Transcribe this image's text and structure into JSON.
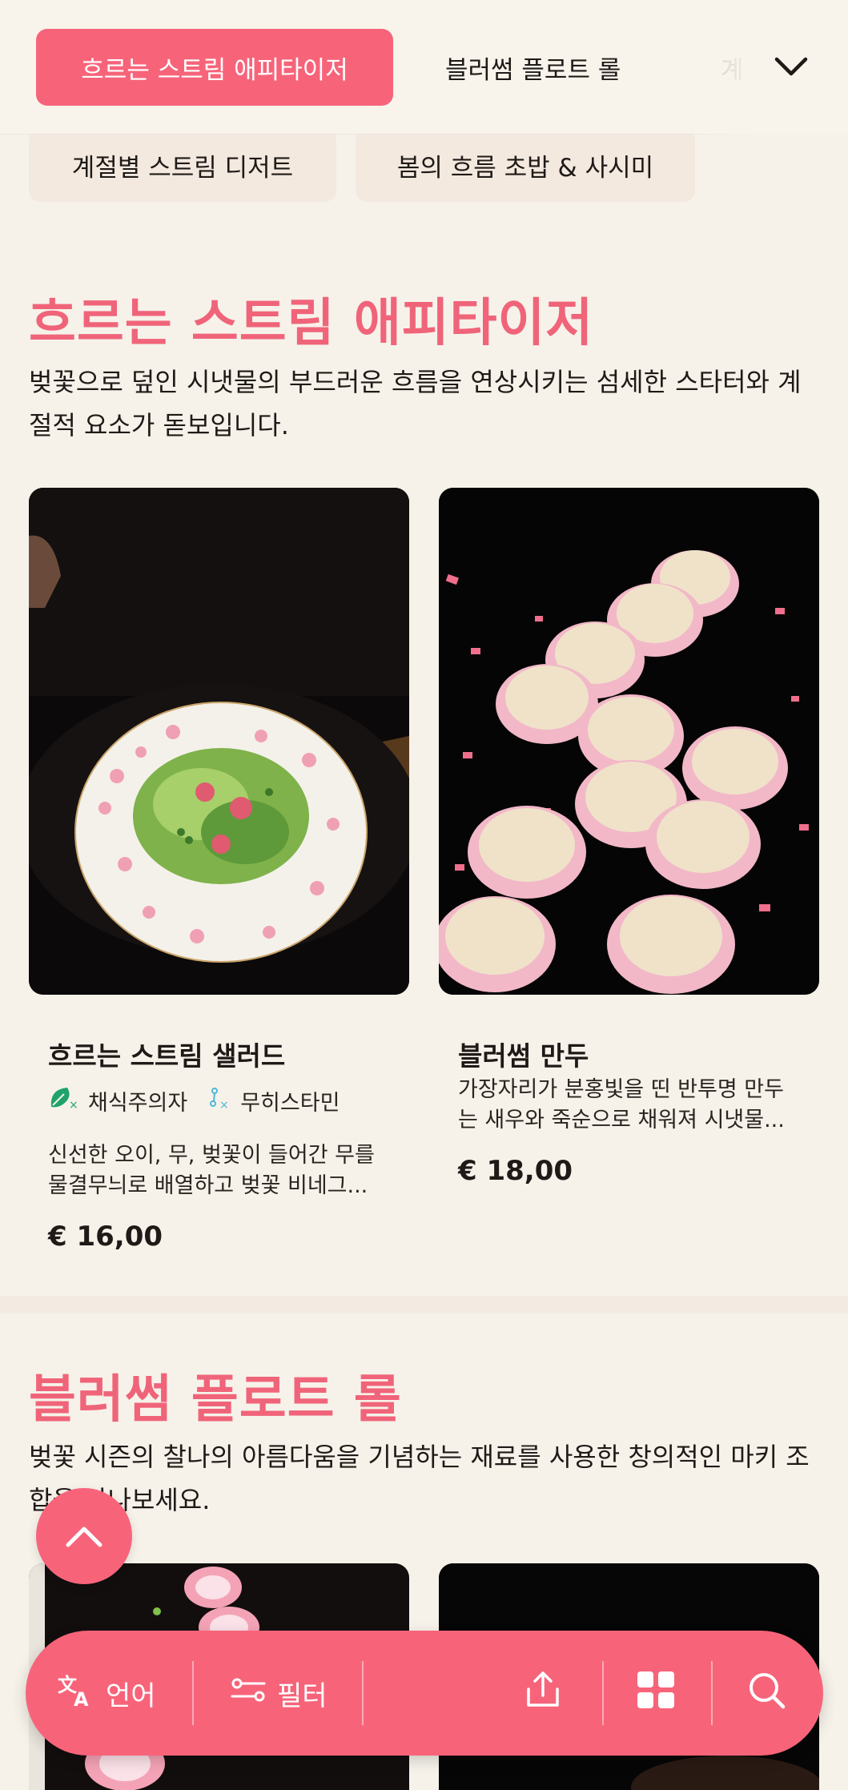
{
  "categories": {
    "active": "흐르는 스트림 애피타이저",
    "tab2": "블러썸 플로트 롤",
    "tab3": "계",
    "chip1": "계절별 스트림 디저트",
    "chip2": "봄의 흐름 초밥 & 사시미"
  },
  "sections": [
    {
      "title": "흐르는 스트림 애피타이저",
      "description": "벚꽃으로 덮인 시냇물의 부드러운 흐름을 연상시키는 섬세한 스타터와 계절적 요소가 돋보입니다.",
      "items": [
        {
          "name": "흐르는 스트림 샐러드",
          "tags": [
            "채식주의자",
            "무히스타민"
          ],
          "description_line1": "신선한 오이, 무, 벚꽃이 들어간 무를",
          "description_line2": "물결무늬로 배열하고 벚꽃 비네그...",
          "price": "€ 16,00"
        },
        {
          "name": "블러썸 만두",
          "description_line1": "가장자리가 분홍빛을 띤 반투명 만두",
          "description_line2": "는 새우와 죽순으로 채워져 시냇물...",
          "price": "€ 18,00"
        }
      ]
    },
    {
      "title": "블러썸 플로트 롤",
      "description": "벚꽃 시즌의 찰나의 아름다움을 기념하는 재료를 사용한 창의적인 마키 조합을 만나보세요."
    }
  ],
  "bottom_bar": {
    "language_label": "언어",
    "filter_label": "필터"
  },
  "colors": {
    "accent": "#f7647a",
    "background": "#f6f2ea",
    "chip": "#f3e9df"
  }
}
